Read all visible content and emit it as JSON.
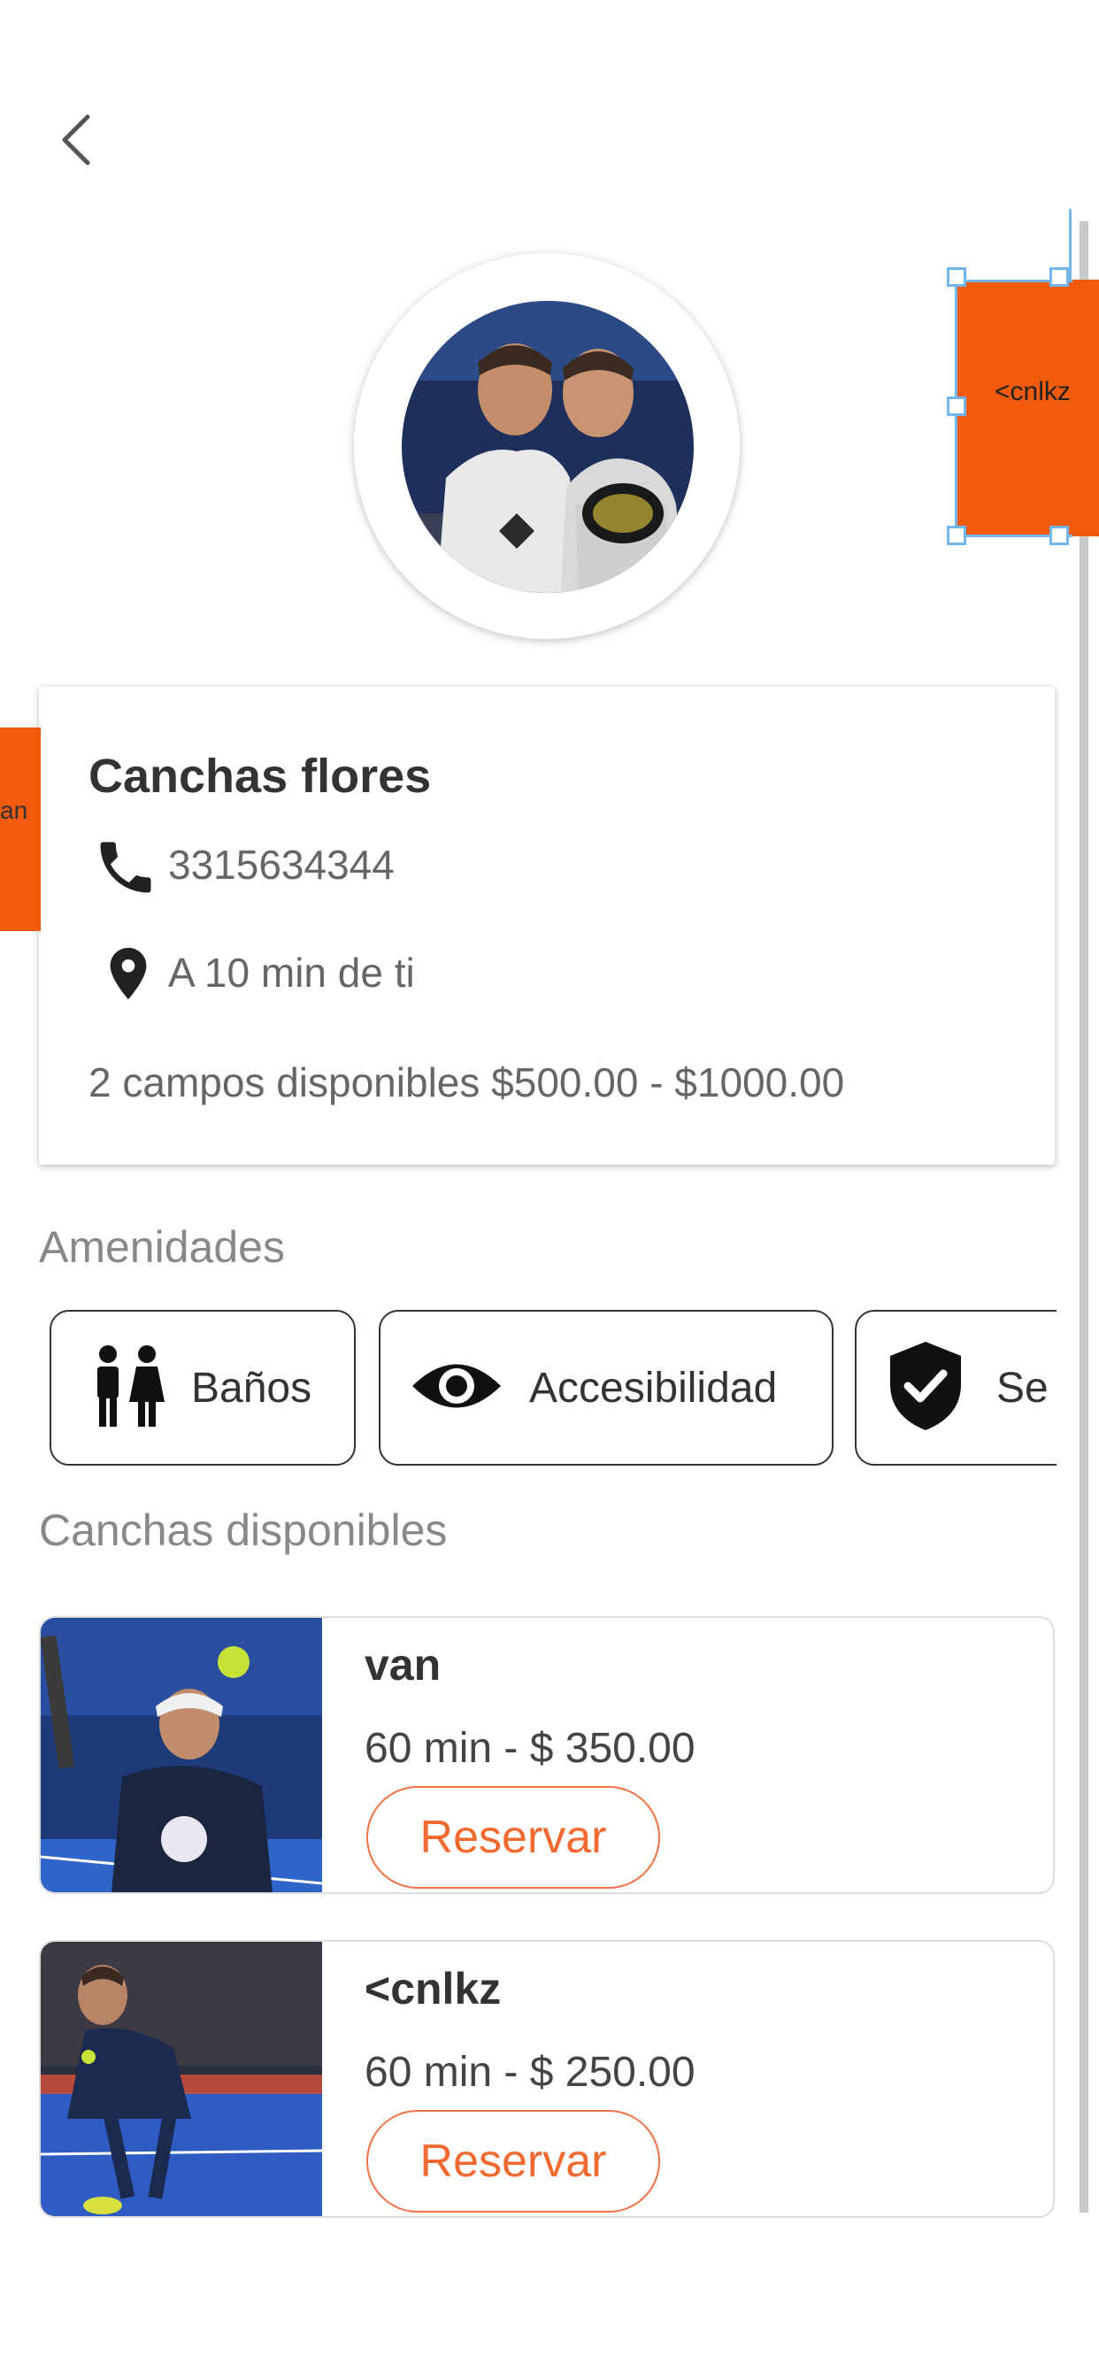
{
  "club": {
    "name": "Canchas flores",
    "phone": "3315634344",
    "distance": "A 10 min de ti",
    "availability": "2 campos disponibles $500.00 - $1000.00"
  },
  "overlays": {
    "right_label": "<cnlkz",
    "left_label": "an"
  },
  "amenities": {
    "title": "Amenidades",
    "items": [
      {
        "label": "Baños",
        "icon": "restroom-icon"
      },
      {
        "label": "Accesibilidad",
        "icon": "eye-icon"
      },
      {
        "label": "Se",
        "icon": "shield-check-icon"
      }
    ]
  },
  "courts": {
    "title": "Canchas disponibles",
    "items": [
      {
        "name": "van",
        "price": "60 min - $ 350.00",
        "button": "Reservar"
      },
      {
        "name": "<cnlkz",
        "price": "60 min - $ 250.00",
        "button": "Reservar"
      }
    ]
  },
  "colors": {
    "accent": "#f26a30",
    "overlay_orange": "#f25a0c",
    "selection_blue": "#71b7ee"
  }
}
